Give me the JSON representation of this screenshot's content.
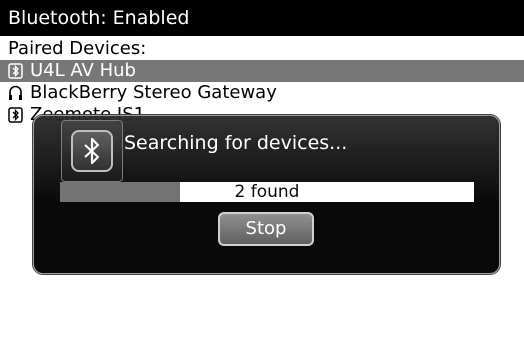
{
  "title_bar": {
    "text": "Bluetooth: Enabled"
  },
  "paired_devices": {
    "label": "Paired Devices:",
    "items": [
      {
        "name": "U4L AV Hub",
        "icon": "bluetooth-device-icon",
        "selected": true
      },
      {
        "name": "BlackBerry Stereo Gateway",
        "icon": "headphones-icon",
        "selected": false
      },
      {
        "name": "Zeemote JS1",
        "icon": "bluetooth-device-icon",
        "selected": false
      }
    ]
  },
  "dialog": {
    "icon": "bluetooth-icon",
    "message": "Searching for devices...",
    "progress": {
      "fraction": 0.29,
      "text": "2 found"
    },
    "stop_label": "Stop"
  },
  "colors": {
    "title_bg": "#000000",
    "selection": "#777777",
    "dialog_bg": "#111111",
    "progress_fill": "#6e6e6e"
  }
}
